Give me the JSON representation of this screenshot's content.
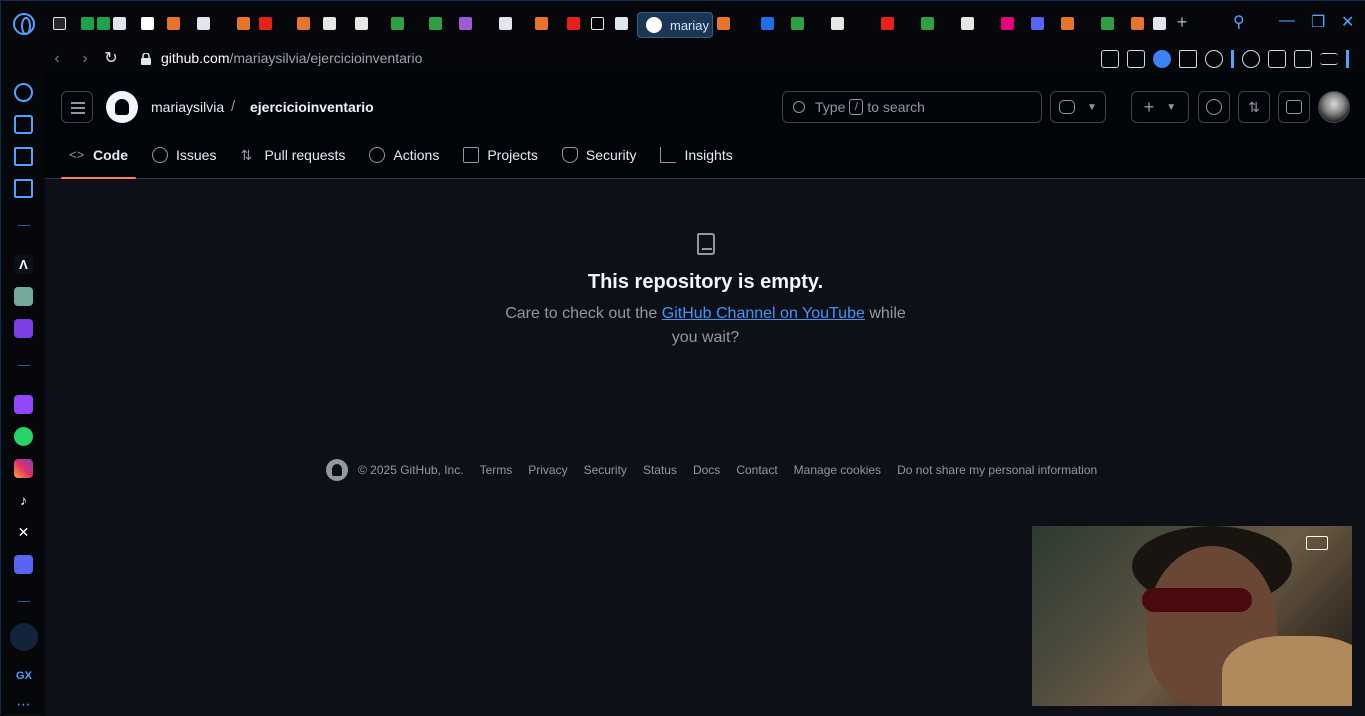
{
  "browser": {
    "active_tab_title": "mariay",
    "url_host": "github.com",
    "url_path": "/mariaysilvia/ejercicioinventario",
    "new_tab_glyph": "+"
  },
  "repo": {
    "owner": "mariaysilvia",
    "separator": "/",
    "name": "ejercicioinventario"
  },
  "search": {
    "placeholder_before": "Type",
    "slash_key": "/",
    "placeholder_after": "to search"
  },
  "repo_nav": [
    {
      "label": "Code",
      "icon": "code-icon"
    },
    {
      "label": "Issues",
      "icon": "issue-icon"
    },
    {
      "label": "Pull requests",
      "icon": "pull-request-icon"
    },
    {
      "label": "Actions",
      "icon": "play-icon"
    },
    {
      "label": "Projects",
      "icon": "table-icon"
    },
    {
      "label": "Security",
      "icon": "shield-icon"
    },
    {
      "label": "Insights",
      "icon": "graph-icon"
    }
  ],
  "empty_state": {
    "title": "This repository is empty.",
    "text_before": "Care to check out the ",
    "link_text": "GitHub Channel on YouTube",
    "text_after": " while you wait?"
  },
  "footer": {
    "copyright": "© 2025 GitHub, Inc.",
    "links": [
      "Terms",
      "Privacy",
      "Security",
      "Status",
      "Docs",
      "Contact",
      "Manage cookies",
      "Do not share my personal information"
    ]
  },
  "sidebar": {
    "bottom_label": "GX"
  },
  "colors": {
    "accent": "#4493f8",
    "tab_underline": "#f78166",
    "opera_blue": "#4fa3ff"
  }
}
